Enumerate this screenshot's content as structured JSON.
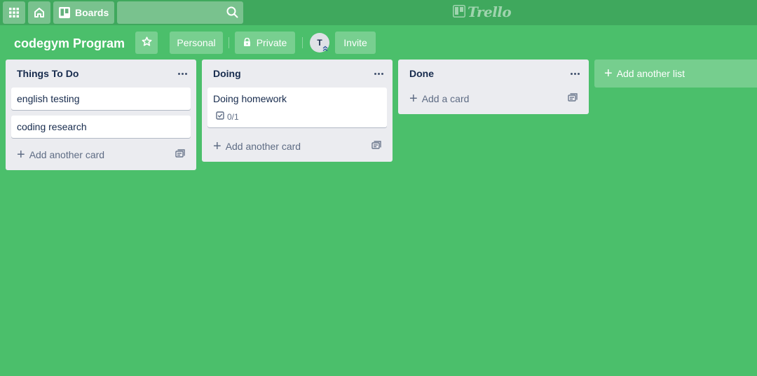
{
  "header": {
    "apps_icon": "grid-icon",
    "home_icon": "home-icon",
    "boards_label": "Boards",
    "search": {
      "value": "",
      "placeholder": ""
    },
    "logo_text": "Trello"
  },
  "board": {
    "title": "codegym Program",
    "personal_label": "Personal",
    "private_label": "Private",
    "avatar_initial": "T",
    "invite_label": "Invite"
  },
  "lists": [
    {
      "title": "Things To Do",
      "cards": [
        {
          "title": "english testing"
        },
        {
          "title": "coding research"
        }
      ],
      "add_label": "Add another card"
    },
    {
      "title": "Doing",
      "cards": [
        {
          "title": "Doing homework",
          "checklist": "0/1"
        }
      ],
      "add_label": "Add another card"
    },
    {
      "title": "Done",
      "cards": [],
      "add_label": "Add a card"
    }
  ],
  "add_list_label": "Add another list",
  "colors": {
    "board_background": "#4bbf6b",
    "header_background": "#3fa85d",
    "list_background": "#ebecf0"
  }
}
